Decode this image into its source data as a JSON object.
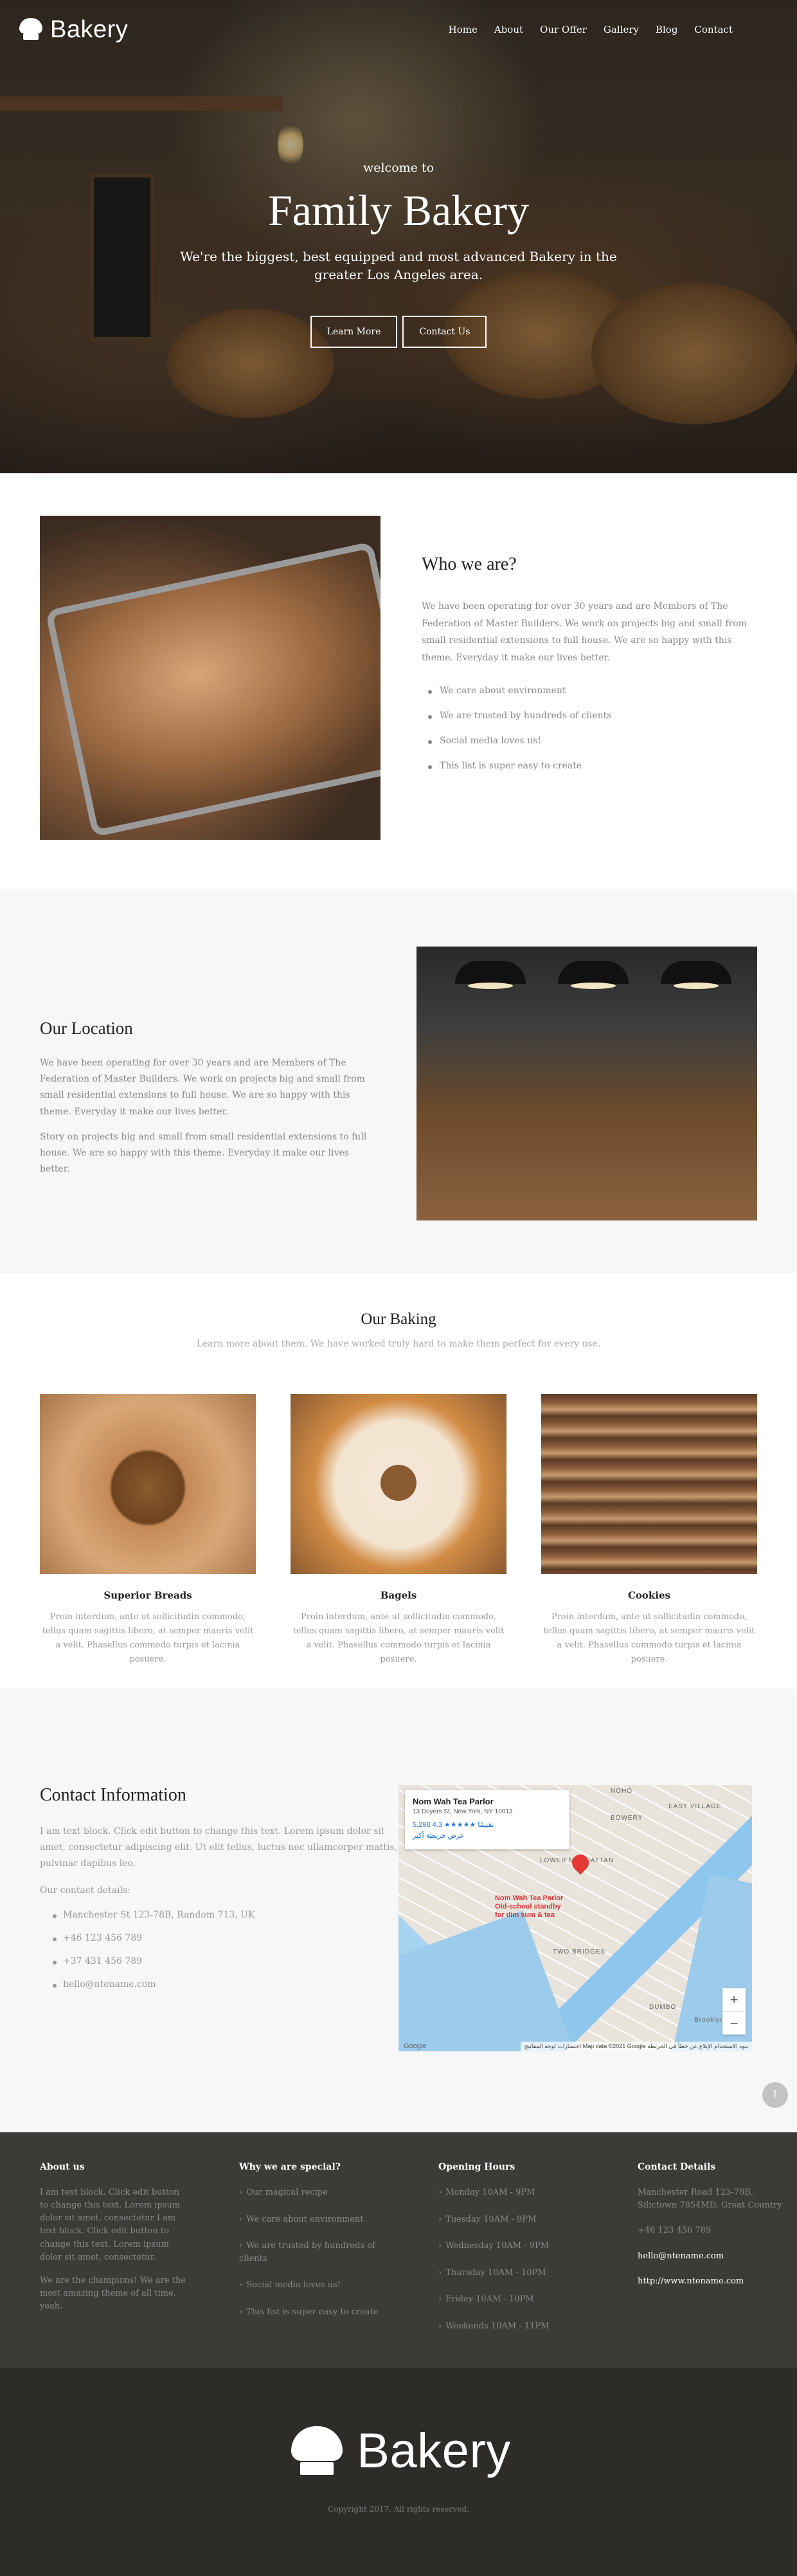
{
  "brand": {
    "name": "Bakery"
  },
  "nav": [
    "Home",
    "About",
    "Our Offer",
    "Gallery",
    "Blog",
    "Contact"
  ],
  "hero": {
    "pre": "welcome to",
    "title": "Family Bakery",
    "text": "We're the biggest, best equipped and most advanced Bakery in the greater Los Angeles area.",
    "btn_learn": "Learn More",
    "btn_contact": "Contact Us"
  },
  "who": {
    "title": "Who we are?",
    "text": "We have been operating for over 30 years and are Members of The Federation of Master Builders. We work on projects big and small from small residential extensions to full house. We are so happy with this theme. Everyday it make our lives better.",
    "items": [
      "We care about environment",
      "We are trusted by hundreds of clients",
      "Social media loves us!",
      "This list is super easy to create"
    ]
  },
  "location": {
    "title": "Our Location",
    "p1": "We have been operating for over 30 years and are Members of The Federation of Master Builders. We work on projects big and small from small residential extensions to full house. We are so happy with this theme. Everyday it make our lives better.",
    "p2": "Story on projects big and small from small residential extensions to full house. We are so happy with this theme. Everyday it make our lives better."
  },
  "baking": {
    "title": "Our Baking",
    "subtitle": "Learn more about them. We have worked truly hard to make them perfect for every use.",
    "cards": [
      {
        "title": "Superior Breads",
        "text": "Proin interdum, ante ut sollicitudin commodo, tellus quam sagittis libero, at semper mauris velit a velit. Phasellus commodo turpis et lacinia posuere."
      },
      {
        "title": "Bagels",
        "text": "Proin interdum, ante ut sollicitudin commodo, tellus quam sagittis libero, at semper mauris velit a velit. Phasellus commodo turpis et lacinia posuere."
      },
      {
        "title": "Cookies",
        "text": "Proin interdum, ante ut sollicitudin commodo, tellus quam sagittis libero, at semper mauris velit a velit. Phasellus commodo turpis et lacinia posuere."
      }
    ]
  },
  "contact": {
    "title": "Contact Information",
    "text": "I am text block. Click edit button to change this text. Lorem ipsum dolor sit amet, consectetur adipiscing elit. Ut elit tellus, luctus nec ullamcorper mattis, pulvinar dapibus leo.",
    "label": "Our contact details:",
    "items": [
      "Manchester St 123-78B, Random 713, UK",
      "+46 123 456 789",
      "+37 431 456 789",
      "hello@ntename.com"
    ]
  },
  "map": {
    "place_name": "Nom Wah Tea Parlor",
    "place_address": "13 Doyers St, New York, NY 10013",
    "rating_text": "5,298 تقييمًا ★★★★★ 4.3",
    "directions": "الاتجاهات",
    "larger_map": "عرض خريطة أكبر",
    "pin_label": "Nom Wah Tea Parlor\nOld-school standby\nfor dim sum & tea",
    "areas": [
      "NOHO",
      "BOWERY",
      "EAST VILLAGE",
      "LOWER MANHATTAN",
      "TWO BRIDGES",
      "DUMBO",
      "Brooklyn"
    ],
    "zoom_in": "+",
    "zoom_out": "−",
    "google": "Google",
    "attribution": "اختصارات لوحة المفاتيح  Map data ©2021 Google  بنود الاستخدام  الإبلاغ عن خطأ في الخريطة"
  },
  "to_top": "↑",
  "footer": {
    "about": {
      "title": "About us",
      "p1": "I am text block. Click edit button to change this text. Lorem ipsum dolor sit amet, consectetur I am text block. Click edit button to change this text. Lorem ipsum dolor sit amet, consectetur.",
      "p2": "We are the champions! We are the most amazing theme of all time, yeah."
    },
    "special": {
      "title": "Why we are special?",
      "items": [
        "Our magical recipe",
        "We care about environment",
        "We are trusted by hundreds of clients",
        "Social media loves us!",
        "This list is super easy to create"
      ]
    },
    "hours": {
      "title": "Opening Hours",
      "items": [
        "Monday 10AM - 9PM",
        "Tuesday 10AM - 9PM",
        "Wednesday 10AM - 9PM",
        "Thursday 10AM - 10PM",
        "Friday 10AM - 10PM",
        "Weekends 10AM - 11PM"
      ]
    },
    "contact": {
      "title": "Contact Details",
      "address": "Manchester Road 123-78B, Silictown 7854MD, Great Country",
      "phone": "+46 123 456 789",
      "email": "hello@ntename.com",
      "web": "http://www.ntename.com"
    }
  },
  "bottom": {
    "copyright": "Copyright 2017. All rights reserved."
  },
  "icons": {
    "logo": "chef-hat-icon",
    "list_chevron": "›"
  },
  "colors": {
    "footer_bg": "#3d3b37",
    "bottom_bg": "#2e2c28",
    "section_alt_bg": "#f7f7f7"
  }
}
